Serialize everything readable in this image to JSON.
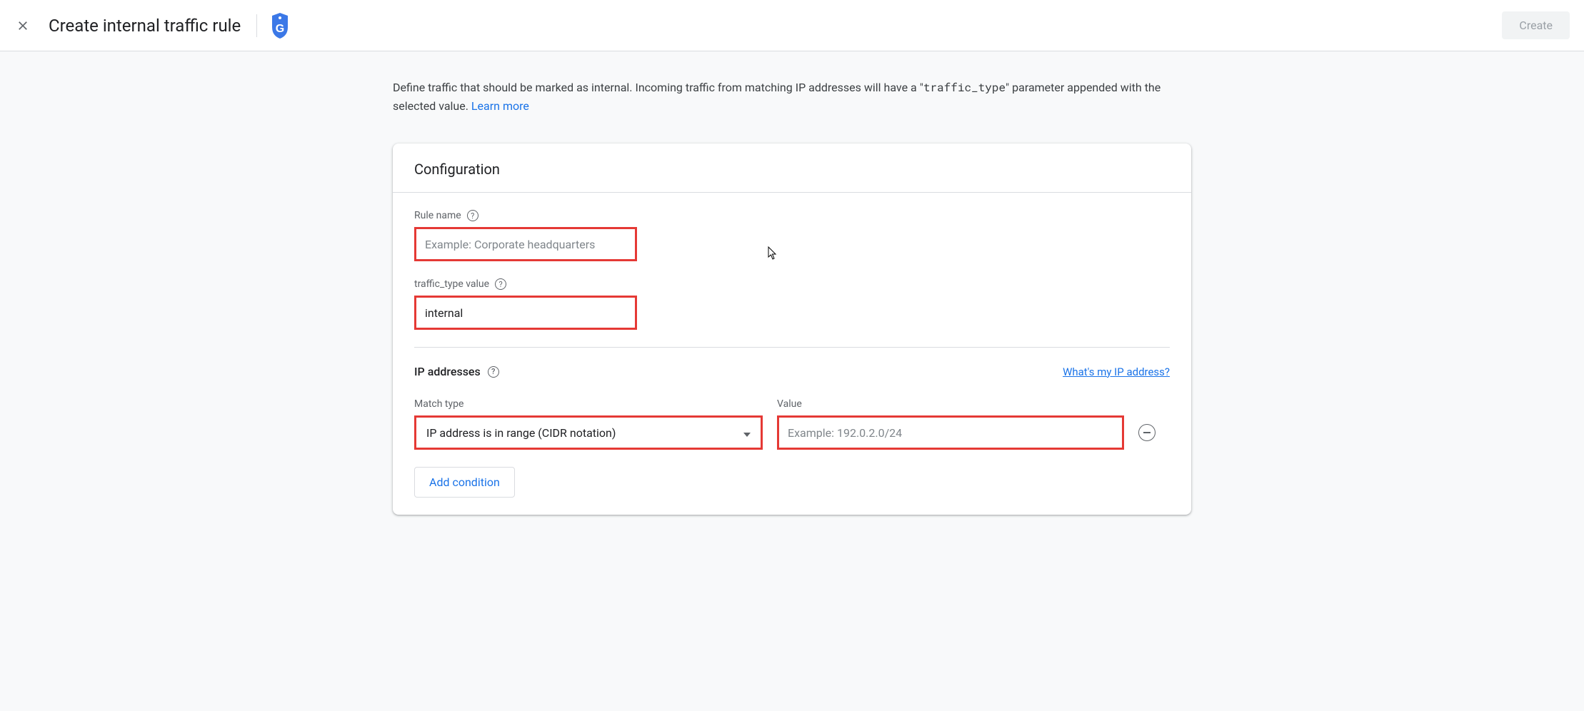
{
  "header": {
    "title": "Create internal traffic rule",
    "create_label": "Create"
  },
  "description": {
    "text_before": "Define traffic that should be marked as internal. Incoming traffic from matching IP addresses will have a \"",
    "code": "traffic_type",
    "text_after": "\" parameter appended with the selected value. ",
    "learn_more": "Learn more"
  },
  "config": {
    "title": "Configuration",
    "rule_name_label": "Rule name",
    "rule_name_placeholder": "Example: Corporate headquarters",
    "rule_name_value": "",
    "traffic_type_label": "traffic_type value",
    "traffic_type_value": "internal"
  },
  "ip_section": {
    "title": "IP addresses",
    "link": "What's my IP address?",
    "match_type_label": "Match type",
    "match_type_value": "IP address is in range (CIDR notation)",
    "value_label": "Value",
    "value_placeholder": "Example: 192.0.2.0/24",
    "value_value": "",
    "add_condition_label": "Add condition"
  }
}
